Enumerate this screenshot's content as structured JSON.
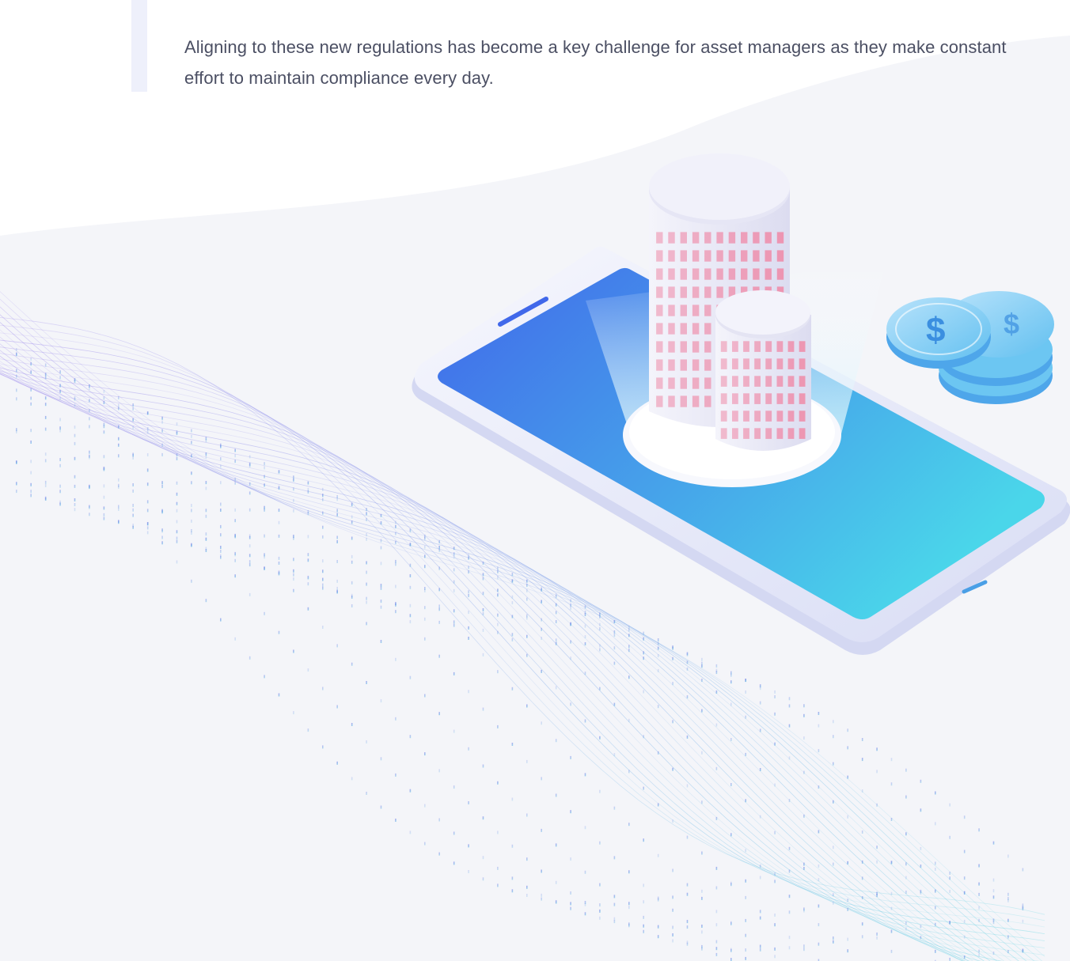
{
  "content": {
    "line1": "Aligning to these new regulations has become a key challenge for asset managers as they make constant",
    "line2": "effort to maintain compliance every day."
  },
  "illustration": {
    "subject": "smartphone with office tower and dollar coins",
    "coin_symbol": "$"
  },
  "colors": {
    "text": "#4b4f63",
    "accent_bar": "#eef0fb",
    "background_shape": "#f3f4f8",
    "screen_start": "#4168ea",
    "screen_end": "#4ad6ea",
    "wave_purple": "#8a6ee8",
    "wave_teal": "#4fd1de",
    "window_pink": "#ef8aa8"
  },
  "icons": [
    "building-icon",
    "phone-icon",
    "dollar-coin-icon",
    "wave-decoration"
  ]
}
